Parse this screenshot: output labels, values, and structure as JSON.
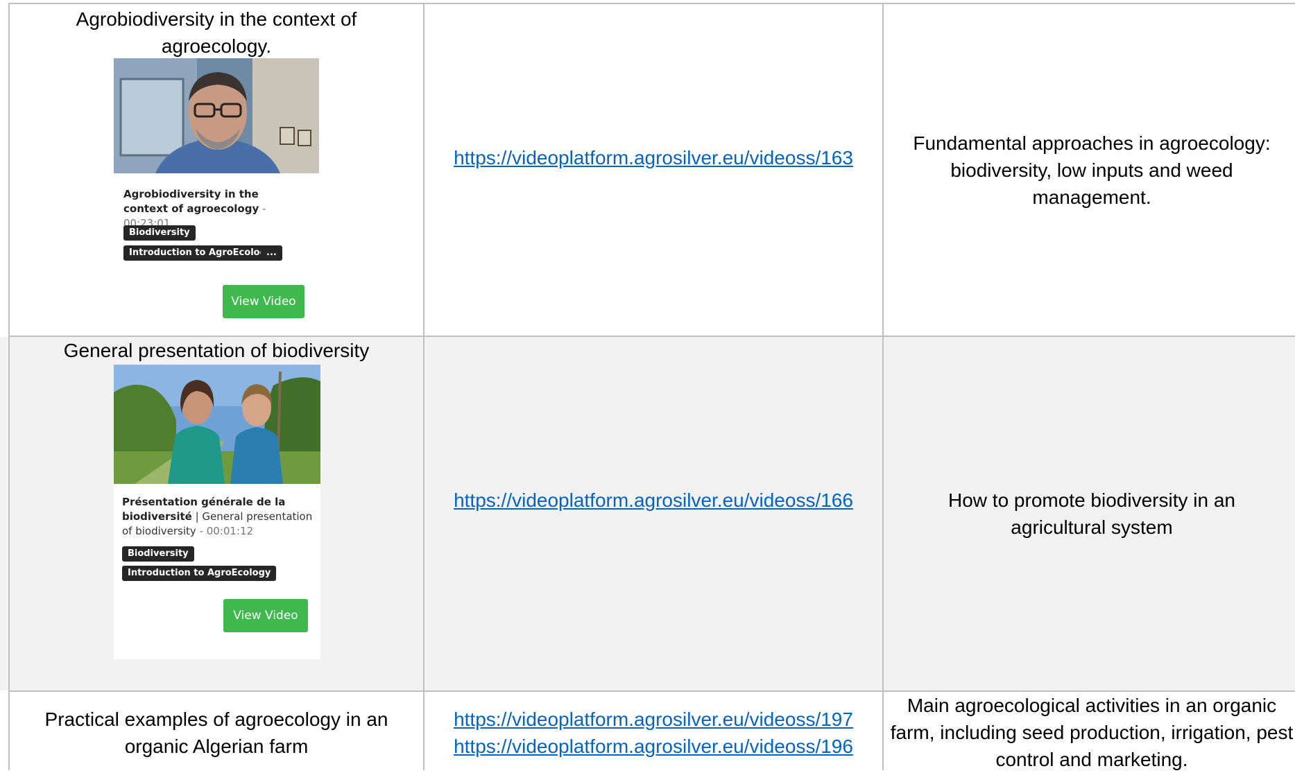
{
  "rows": [
    {
      "title": "Agrobiodiversity in the context of agroecology.",
      "card": {
        "title_bold": "Agrobiodiversity in the context of agroecology",
        "title_rest": "",
        "duration": " - 00:23:01",
        "tags": [
          "Biodiversity",
          "Introduction to AgroEcology",
          "..."
        ],
        "button": "View Video"
      },
      "links": [
        "https://videoplatform.agrosilver.eu/videoss/163"
      ],
      "description": "Fundamental approaches in agroecology: biodiversity, low inputs and weed management."
    },
    {
      "title": "General presentation of biodiversity",
      "card": {
        "title_bold": "Présentation générale de la biodiversité",
        "title_rest": " | General presentation of biodiversity",
        "duration": " - 00:01:12",
        "tags": [
          "Biodiversity",
          "Introduction to AgroEcology"
        ],
        "button": "View Video"
      },
      "links": [
        "https://videoplatform.agrosilver.eu/videoss/166"
      ],
      "description": "How to promote biodiversity in an agricultural system"
    },
    {
      "title": "Practical examples of agroecology in an organic Algerian farm",
      "links": [
        "https://videoplatform.agrosilver.eu/videoss/197",
        "https://videoplatform.agrosilver.eu/videoss/196"
      ],
      "description": "Main agroecological activities in an organic farm, including seed production, irrigation, pest control and marketing."
    }
  ]
}
